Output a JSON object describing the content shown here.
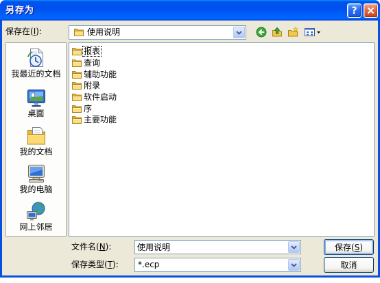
{
  "window": {
    "title": "另存为",
    "help_label": "?"
  },
  "colors": {
    "window_frame": "#0A4FE0",
    "dialog_background": "#ECE9D8",
    "field_border": "#7F9DB9",
    "button_border": "#003C74",
    "list_background": "#FFFFFF"
  },
  "save_in": {
    "label": "保存在(I):",
    "value": "使用说明",
    "icon": "folder-icon"
  },
  "toolbar": {
    "back": {
      "icon": "back-arrow-icon"
    },
    "up_one_level": {
      "icon": "up-one-level-icon"
    },
    "new_folder": {
      "icon": "new-folder-icon"
    },
    "view_menu": {
      "icon": "view-menu-icon"
    }
  },
  "places": [
    {
      "label": "我最近的文档",
      "icon": "recent-documents-icon"
    },
    {
      "label": "桌面",
      "icon": "desktop-icon"
    },
    {
      "label": "我的文档",
      "icon": "my-documents-icon"
    },
    {
      "label": "我的电脑",
      "icon": "my-computer-icon"
    },
    {
      "label": "网上邻居",
      "icon": "network-places-icon"
    }
  ],
  "file_list": {
    "items": [
      {
        "name": "报表",
        "icon": "folder-icon",
        "focused": true
      },
      {
        "name": "查询",
        "icon": "folder-icon"
      },
      {
        "name": "辅助功能",
        "icon": "folder-icon"
      },
      {
        "name": "附录",
        "icon": "folder-icon"
      },
      {
        "name": "软件启动",
        "icon": "folder-icon"
      },
      {
        "name": "序",
        "icon": "folder-icon"
      },
      {
        "name": "主要功能",
        "icon": "folder-icon"
      }
    ]
  },
  "file_name": {
    "label": "文件名(N):",
    "value": "使用说明"
  },
  "save_as_type": {
    "label": "保存类型(T):",
    "value": "*.ecp"
  },
  "buttons": {
    "save": "保存(S)",
    "cancel": "取消"
  }
}
